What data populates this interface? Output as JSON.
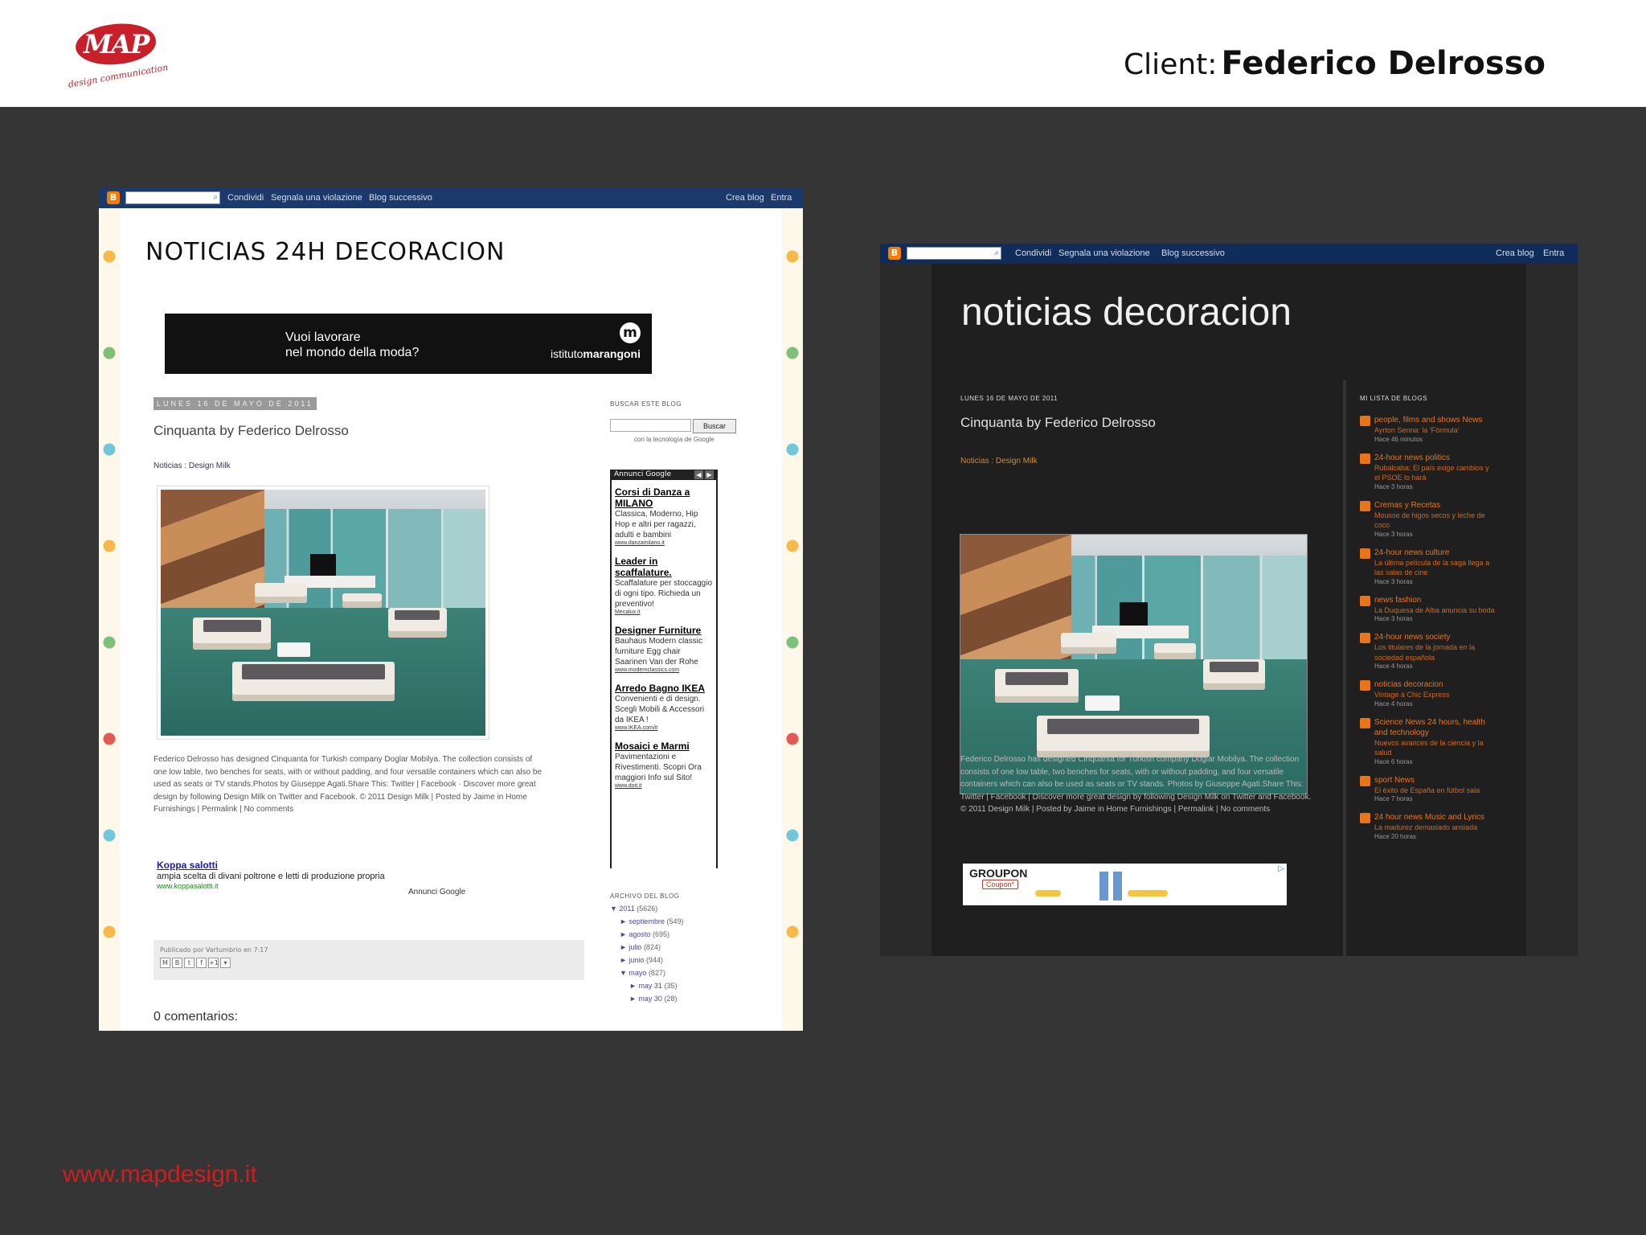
{
  "slide": {
    "logo": {
      "mark": "MAP",
      "tagline": "design communication"
    },
    "client_label": "Client:",
    "client_name": "Federico Delrosso",
    "footer_url": "www.mapdesign.it"
  },
  "screenshot1": {
    "navbar": {
      "links": [
        "Condividi",
        "Segnala una violazione",
        "Blog successivo"
      ],
      "right_links": [
        "Crea blog",
        "Entra"
      ]
    },
    "blog_title": "Noticias 24h decoracion",
    "banner": {
      "text_line1": "Vuoi lavorare",
      "text_line2": "nel mondo della moda?",
      "brand_prefix": "istituto",
      "brand_name": "marangoni",
      "brand_mark": "m"
    },
    "post": {
      "date": "LUNES 16 DE MAYO DE 2011",
      "title": "Cinquanta by Federico Delrosso",
      "tags": "Noticias : Design Milk",
      "body": "Federico Delrosso has designed Cinquanta for Turkish company Doglar Mobilya. The collection consists of one low table, two benches for seats, with or without padding, and four versatile containers which can also be used as seats or TV stands.Photos by Giuseppe Agati.Share This: Twitter | Facebook · Discover more great design by following Design Milk on Twitter and Facebook. © 2011 Design Milk | Posted by Jaime in Home Furnishings | Permalink | No comments"
    },
    "text_ad": {
      "title": "Koppa salotti",
      "desc": "ampia scelta di divani poltrone e letti di produzione propria",
      "url": "www.koppasalotti.it"
    },
    "ads_by": "Annunci Google",
    "share": {
      "posted": "Publicado por Vartumbrio en 7:17",
      "icons": [
        "M",
        "B",
        "t",
        "f",
        "+1",
        "▾"
      ]
    },
    "comments_label": "0 comentarios:",
    "sidebar": {
      "search_heading": "BUSCAR ESTE BLOG",
      "search_button": "Buscar",
      "powered": "con la tecnología de Google",
      "ads_header": "Annunci Google",
      "ads": [
        {
          "title": "Corsi di Danza a MILANO",
          "desc": "Classica, Moderno, Hip Hop e altri per ragazzi, adulti e bambini",
          "url": "www.danzamilano.it"
        },
        {
          "title": "Leader in scaffalature.",
          "desc": "Scaffalature per stoccaggio di ogni tipo. Richieda un preventivo!",
          "url": "Mecalux.it"
        },
        {
          "title": "Designer Furniture",
          "desc": "Bauhaus Modern classic furniture Egg chair Saarinen Van der Rohe",
          "url": "www.modernclassics.com"
        },
        {
          "title": "Arredo Bagno IKEA",
          "desc": "Convenienti e di design. Scegli Mobili & Accessori da IKEA !",
          "url": "www.IKEA.com/it"
        },
        {
          "title": "Mosaici e Marmi",
          "desc": "Pavimentazioni e Rivestimenti. Scopri Ora maggiori Info sul Sito!",
          "url": "www.doit.it"
        }
      ],
      "archive_heading": "ARCHIVO DEL BLOG",
      "archive": [
        {
          "label": "▼  2011",
          "count": "(5626)"
        },
        {
          "label": "►  septiembre",
          "count": "(549)"
        },
        {
          "label": "►  agosto",
          "count": "(695)"
        },
        {
          "label": "►  julio",
          "count": "(824)"
        },
        {
          "label": "►  junio",
          "count": "(944)"
        },
        {
          "label": "▼  mayo",
          "count": "(827)"
        },
        {
          "label": "►  may 31",
          "count": "(35)"
        },
        {
          "label": "►  may 30",
          "count": "(28)"
        }
      ]
    }
  },
  "screenshot2": {
    "navbar": {
      "links": [
        "Condividi",
        "Segnala una violazione",
        "Blog successivo"
      ],
      "right_links": [
        "Crea blog",
        "Entra"
      ]
    },
    "blog_title": "noticias decoracion",
    "post": {
      "date": "LUNES 16 DE MAYO DE 2011",
      "title": "Cinquanta by Federico Delrosso",
      "tags": "Noticias : Design Milk",
      "body": "Federico Delrosso has designed Cinquanta for Turkish company Doglar Mobilya. The collection consists of one low table, two benches for seats, with or without padding, and four versatile containers which can also be used as seats or TV stands. Photos by Giuseppe Agati.Share This: Twitter | Facebook | Discover more great design by following Design Milk on Twitter and Facebook. © 2011 Design Milk | Posted by Jaime in Home Furnishings | Permalink | No comments"
    },
    "ad": {
      "brand": "GROUPON",
      "coupon": "Coupon*"
    },
    "bloglist_heading": "MI LISTA DE BLOGS",
    "bloglist": [
      {
        "name": "people, films and shows News",
        "snippet": "Ayrton Senna: la 'Fórmula'",
        "time": "Hace 46 minutos"
      },
      {
        "name": "24-hour news politics",
        "snippet": "Rubalcaba: El país exige cambios y el PSOE lo hará",
        "time": "Hace 3 horas"
      },
      {
        "name": "Cremas y Recetas",
        "snippet": "Mousse de higos secos y leche de coco",
        "time": "Hace 3 horas"
      },
      {
        "name": "24-hour news culture",
        "snippet": "La última película de la saga llega a las salas de cine",
        "time": "Hace 3 horas"
      },
      {
        "name": "news fashion",
        "snippet": "La Duquesa de Alba anuncia su boda",
        "time": "Hace 3 horas"
      },
      {
        "name": "24-hour news society",
        "snippet": "Los titulares de la jornada en la sociedad española",
        "time": "Hace 4 horas"
      },
      {
        "name": "noticias decoracion",
        "snippet": "Vintage à Chic Express",
        "time": "Hace 4 horas"
      },
      {
        "name": "Science News 24 hours, health and technology",
        "snippet": "Nuevos avances de la ciencia y la salud",
        "time": "Hace 6 horas"
      },
      {
        "name": "sport News",
        "snippet": "El éxito de España en fútbol sala",
        "time": "Hace 7 horas"
      },
      {
        "name": "24 hour news Music and Lyrics",
        "snippet": "La madurez demasiado ansiada",
        "time": "Hace 20 horas"
      }
    ]
  }
}
